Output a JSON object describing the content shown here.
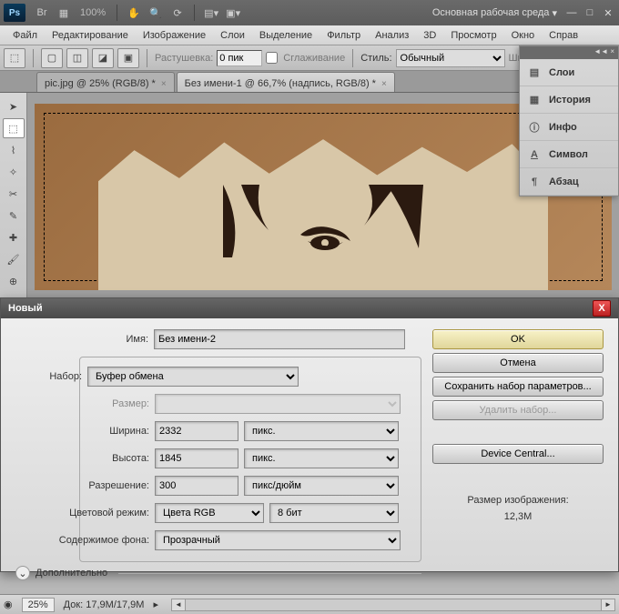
{
  "appbar": {
    "logo": "Ps",
    "zoom": "100%",
    "workspace_label": "Основная рабочая среда"
  },
  "menu": [
    "Файл",
    "Редактирование",
    "Изображение",
    "Слои",
    "Выделение",
    "Фильтр",
    "Анализ",
    "3D",
    "Просмотр",
    "Окно",
    "Справ"
  ],
  "options": {
    "feather_label": "Растушевка:",
    "feather_value": "0 пик",
    "antialias_label": "Сглаживание",
    "style_label": "Стиль:",
    "style_value": "Обычный",
    "width_label": "Ши"
  },
  "doc_tabs": [
    {
      "label": "pic.jpg @ 25% (RGB/8) *",
      "active": false
    },
    {
      "label": "Без имени-1 @ 66,7% (надпись, RGB/8) *",
      "active": true
    }
  ],
  "dock": {
    "items": [
      {
        "icon": "layers",
        "label": "Слои"
      },
      {
        "icon": "history",
        "label": "История"
      },
      {
        "icon": "info",
        "label": "Инфо"
      },
      {
        "icon": "character",
        "label": "Символ"
      },
      {
        "icon": "paragraph",
        "label": "Абзац"
      }
    ]
  },
  "dialog": {
    "title": "Новый",
    "name_label": "Имя:",
    "name_value": "Без имени-2",
    "preset_label": "Набор:",
    "preset_value": "Буфер обмена",
    "size_label": "Размер:",
    "width_label": "Ширина:",
    "width_value": "2332",
    "width_unit": "пикс.",
    "height_label": "Высота:",
    "height_value": "1845",
    "height_unit": "пикс.",
    "res_label": "Разрешение:",
    "res_value": "300",
    "res_unit": "пикс/дюйм",
    "mode_label": "Цветовой режим:",
    "mode_value": "Цвета RGB",
    "mode_depth": "8 бит",
    "bg_label": "Содержимое фона:",
    "bg_value": "Прозрачный",
    "advanced_label": "Дополнительно",
    "btn_ok": "OK",
    "btn_cancel": "Отмена",
    "btn_save_preset": "Сохранить набор параметров...",
    "btn_del_preset": "Удалить набор...",
    "btn_device": "Device Central...",
    "size_info_label": "Размер изображения:",
    "size_info_value": "12,3M"
  },
  "status": {
    "zoom": "25%",
    "doc": "Док: 17,9M/17,9M"
  }
}
